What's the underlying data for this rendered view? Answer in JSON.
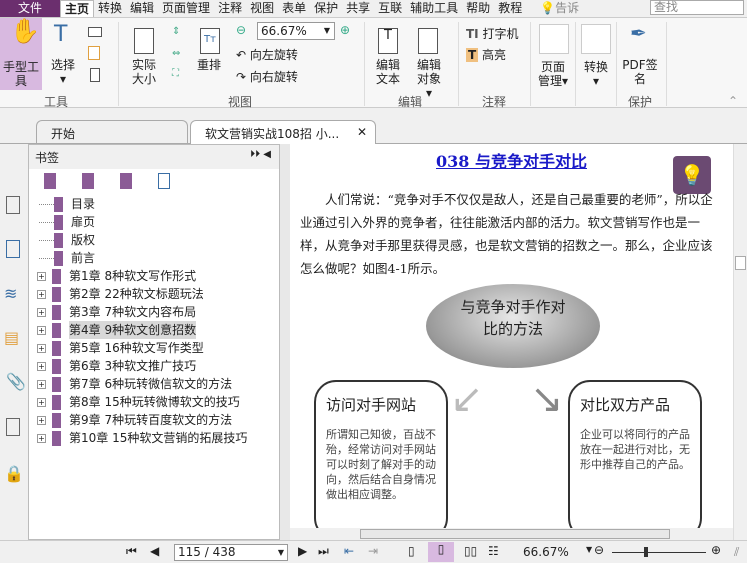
{
  "menubar": {
    "file": "文件",
    "items": [
      "主页",
      "转换",
      "编辑",
      "页面管理",
      "注释",
      "视图",
      "表单",
      "保护",
      "共享",
      "互联",
      "辅助工具",
      "帮助",
      "教程"
    ],
    "tell": "告诉",
    "search_placeholder": "查找"
  },
  "ribbon": {
    "tools": {
      "hand": "手型工具",
      "select": "选择",
      "label": "工具"
    },
    "view": {
      "actual": "实际大小",
      "reflow": "重排",
      "zoom": "66.67%",
      "rotate_left": "向左旋转",
      "rotate_right": "向右旋转",
      "label": "视图"
    },
    "edit": {
      "text": "编辑文本",
      "object": "编辑对象",
      "label": "编辑"
    },
    "comment": {
      "typewriter": "打字机",
      "highlight": "高亮",
      "label": "注释"
    },
    "page": {
      "manage": "页面管理"
    },
    "convert": {
      "convert": "转换"
    },
    "protect": {
      "sign": "PDF签名",
      "label": "保护"
    }
  },
  "tabs": [
    {
      "label": "开始"
    },
    {
      "label": "软文营销实战108招 小..."
    }
  ],
  "bookmarks": {
    "title": "书签",
    "items": [
      {
        "label": "目录",
        "expandable": false
      },
      {
        "label": "扉页",
        "expandable": false
      },
      {
        "label": "版权",
        "expandable": false
      },
      {
        "label": "前言",
        "expandable": false
      },
      {
        "label": "第1章 8种软文写作形式",
        "expandable": true
      },
      {
        "label": "第2章 22种软文标题玩法",
        "expandable": true
      },
      {
        "label": "第3章 7种软文内容布局",
        "expandable": true
      },
      {
        "label": "第4章 9种软文创意招数",
        "expandable": true,
        "selected": true
      },
      {
        "label": "第5章 16种软文写作类型",
        "expandable": true
      },
      {
        "label": "第6章 3种软文推广技巧",
        "expandable": true
      },
      {
        "label": "第7章 6种玩转微信软文的方法",
        "expandable": true
      },
      {
        "label": "第8章 15种玩转微博软文的技巧",
        "expandable": true
      },
      {
        "label": "第9章 7种玩转百度软文的方法",
        "expandable": true
      },
      {
        "label": "第10章 15种软文营销的拓展技巧",
        "expandable": true
      }
    ]
  },
  "document": {
    "title": "038 与竞争对手对比",
    "paragraph": "人们常说：“竞争对手不仅仅是敌人，还是自己最重要的老师”，所以企业通过引入外界的竞争者，往往能激活内部的活力。软文营销写作也是一样，从竞争对手那里获得灵感，也是软文营销的招数之一。那么，企业应该怎么做呢？如图4-1所示。",
    "diagram": {
      "center": "与竞争对手作对比的方法",
      "left_title": "访问对手网站",
      "left_text": "所谓知己知彼，百战不殆，经常访问对手网站可以时刻了解对手的动向，然后结合自身情况做出相应调整。",
      "right_title": "对比双方产品",
      "right_text": "企业可以将同行的产品放在一起进行对比，无形中推荐自己的产品。"
    }
  },
  "status": {
    "page": "115 / 438",
    "zoom": "66.67%"
  },
  "colors": {
    "accent": "#6b2f6e",
    "bookmark": "#8b5b96",
    "link": "#1a1ac8"
  }
}
